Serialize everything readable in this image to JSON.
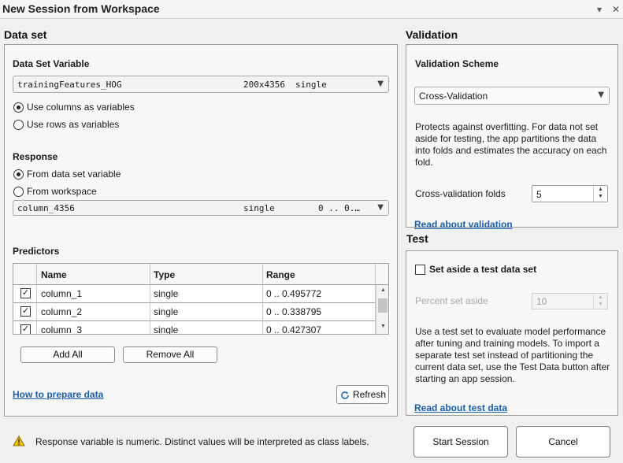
{
  "window": {
    "title": "New Session from Workspace",
    "dropdown_icon": "chevron-down-icon",
    "close_icon": "close-icon",
    "menu_glyph": "▾",
    "close_glyph": "✕"
  },
  "dataset": {
    "section_title": "Data set",
    "variable_label": "Data Set Variable",
    "variable": {
      "name": "trainingFeatures_HOG",
      "size": "200x4356",
      "type": "single"
    },
    "orientation_options": [
      {
        "label": "Use columns as variables",
        "selected": true
      },
      {
        "label": "Use rows as variables",
        "selected": false
      }
    ],
    "response_label": "Response",
    "response_options": [
      {
        "label": "From data set variable",
        "selected": true
      },
      {
        "label": "From workspace",
        "selected": false
      }
    ],
    "response_variable": {
      "name": "column_4356",
      "type": "single",
      "range": "0 .. 0.…"
    },
    "predictors_label": "Predictors",
    "predictors_columns": [
      "Name",
      "Type",
      "Range"
    ],
    "predictors_rows": [
      {
        "checked": true,
        "name": "column_1",
        "type": "single",
        "range": "0 .. 0.495772"
      },
      {
        "checked": true,
        "name": "column_2",
        "type": "single",
        "range": "0 .. 0.338795"
      },
      {
        "checked": true,
        "name": "column_3",
        "type": "single",
        "range": "0 .. 0.427307"
      }
    ],
    "add_all_label": "Add All",
    "remove_all_label": "Remove All",
    "how_to_link": "How to prepare data",
    "refresh_label": "Refresh"
  },
  "validation": {
    "section_title": "Validation",
    "scheme_label": "Validation Scheme",
    "scheme_value": "Cross-Validation",
    "description": "Protects against overfitting. For data not set aside for testing, the app partitions the data into folds and estimates the accuracy on each fold.",
    "folds_label": "Cross-validation folds",
    "folds_value": "5",
    "read_link": "Read about validation"
  },
  "test": {
    "section_title": "Test",
    "set_aside_label": "Set aside a test data set",
    "set_aside_checked": false,
    "percent_label": "Percent set aside",
    "percent_value": "10",
    "description": "Use a test set to evaluate model performance after tuning and training models. To import a separate test set instead of partitioning the current data set, use the Test Data button after starting an app session.",
    "read_link": "Read about test data"
  },
  "footer": {
    "warning_icon": "warning-icon",
    "warning_text": "Response variable is numeric. Distinct values will be interpreted as class labels.",
    "start_label": "Start Session",
    "cancel_label": "Cancel"
  },
  "colors": {
    "link": "#1b5ea8",
    "warning": "#f2c200",
    "panel_border": "#9a9a9a"
  }
}
